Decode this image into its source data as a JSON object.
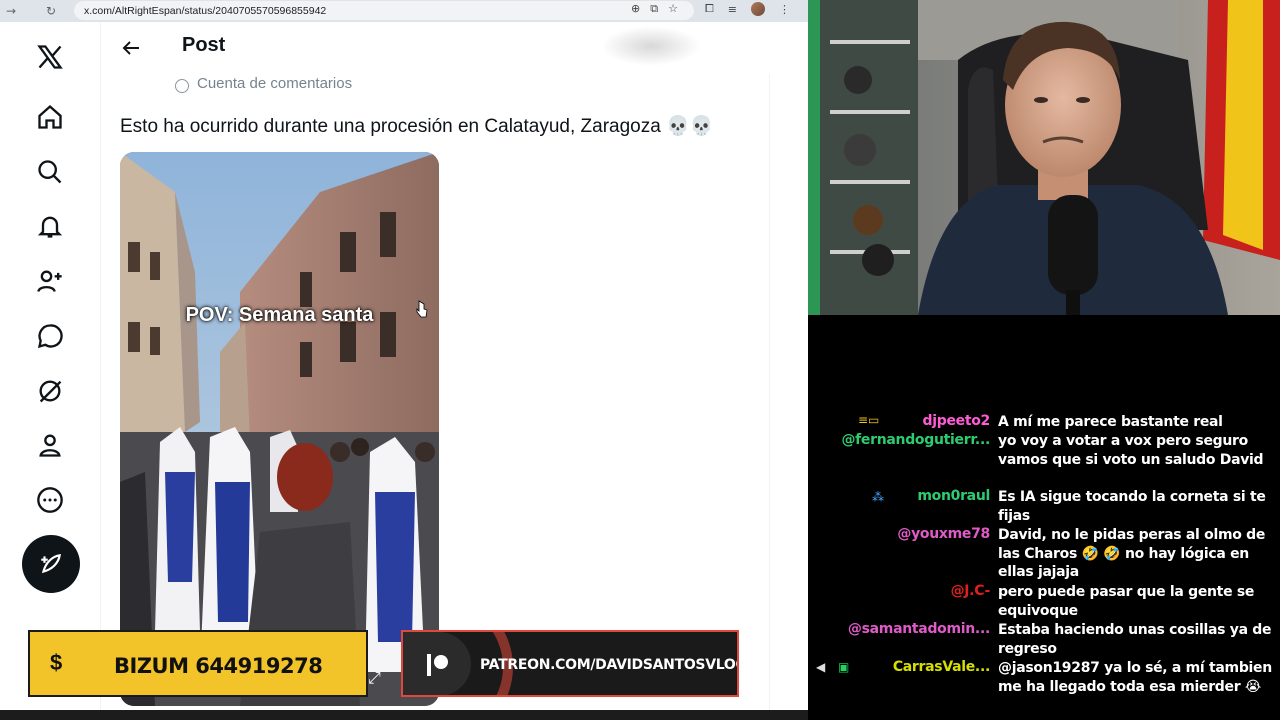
{
  "browser": {
    "url": "x.com/AltRightEspan/status/2040705570596855942"
  },
  "post": {
    "header_title": "Post",
    "community": "Cuenta de comentarios",
    "text": "Esto ha ocurrido durante una procesión en Calatayud, Zaragoza 💀💀",
    "media_caption": "POV: Semana santa"
  },
  "sidebar": {
    "items": [
      "x-logo",
      "home-icon",
      "search-icon",
      "notifications-icon",
      "follow-icon",
      "messages-icon",
      "grok-icon",
      "profile-icon",
      "more-icon",
      "compose-icon"
    ]
  },
  "banners": {
    "bizum_symbol": "$",
    "bizum_text": "BIZUM 644919278",
    "patreon_text": "PATREON.COM/DAVIDSANTOSVLOG"
  },
  "chat": {
    "messages": [
      {
        "user": "djpeeto2",
        "color": "#ff5bd6",
        "text": "A mí me parece bastante real"
      },
      {
        "user": "@fernandogutierr...",
        "color": "#2ecc71",
        "text": "yo voy a votar a vox pero seguro vamos que si voto un saludo David"
      },
      {
        "user": "mon0raul",
        "color": "#2ecc71",
        "text": "Es IA sigue tocando la corneta si te fijas"
      },
      {
        "user": "@youxme78",
        "color": "#e05ac8",
        "text": "David, no le pidas peras al olmo de las Charos 🤣 🤣 no hay lógica en ellas jajaja"
      },
      {
        "user": "@J.C-",
        "color": "#e02020",
        "text": "pero puede pasar que la gente se equivoque"
      },
      {
        "user": "@samantadomin...",
        "color": "#e05ac8",
        "text": "Estaba haciendo unas cosillas ya de regreso"
      },
      {
        "user": "CarrasVale...",
        "color": "#d6e000",
        "text": "@jason19287 ya lo sé, a mí tambien me ha llegado toda esa mierder 😭"
      }
    ]
  }
}
